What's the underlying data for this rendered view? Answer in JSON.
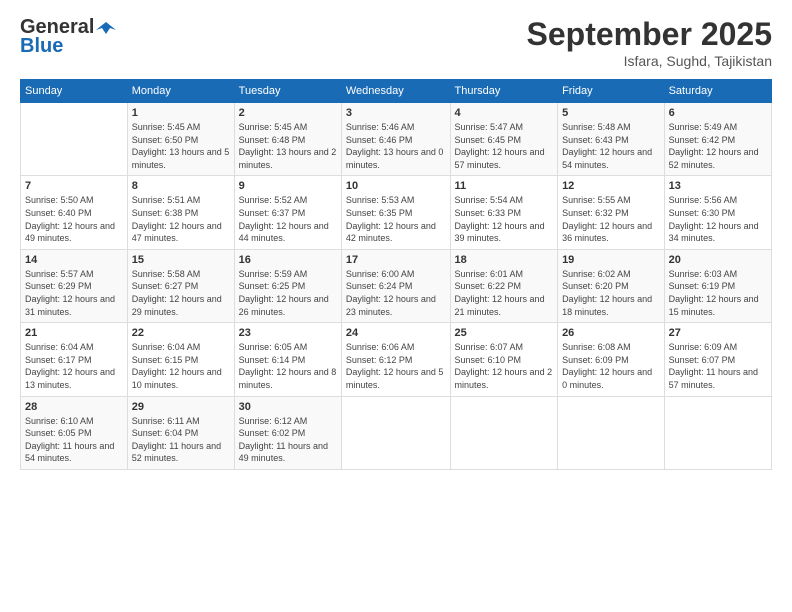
{
  "header": {
    "logo_general": "General",
    "logo_blue": "Blue",
    "month": "September 2025",
    "location": "Isfara, Sughd, Tajikistan"
  },
  "weekdays": [
    "Sunday",
    "Monday",
    "Tuesday",
    "Wednesday",
    "Thursday",
    "Friday",
    "Saturday"
  ],
  "weeks": [
    [
      {
        "day": "",
        "sunrise": "",
        "sunset": "",
        "daylight": ""
      },
      {
        "day": "1",
        "sunrise": "Sunrise: 5:45 AM",
        "sunset": "Sunset: 6:50 PM",
        "daylight": "Daylight: 13 hours and 5 minutes."
      },
      {
        "day": "2",
        "sunrise": "Sunrise: 5:45 AM",
        "sunset": "Sunset: 6:48 PM",
        "daylight": "Daylight: 13 hours and 2 minutes."
      },
      {
        "day": "3",
        "sunrise": "Sunrise: 5:46 AM",
        "sunset": "Sunset: 6:46 PM",
        "daylight": "Daylight: 13 hours and 0 minutes."
      },
      {
        "day": "4",
        "sunrise": "Sunrise: 5:47 AM",
        "sunset": "Sunset: 6:45 PM",
        "daylight": "Daylight: 12 hours and 57 minutes."
      },
      {
        "day": "5",
        "sunrise": "Sunrise: 5:48 AM",
        "sunset": "Sunset: 6:43 PM",
        "daylight": "Daylight: 12 hours and 54 minutes."
      },
      {
        "day": "6",
        "sunrise": "Sunrise: 5:49 AM",
        "sunset": "Sunset: 6:42 PM",
        "daylight": "Daylight: 12 hours and 52 minutes."
      }
    ],
    [
      {
        "day": "7",
        "sunrise": "Sunrise: 5:50 AM",
        "sunset": "Sunset: 6:40 PM",
        "daylight": "Daylight: 12 hours and 49 minutes."
      },
      {
        "day": "8",
        "sunrise": "Sunrise: 5:51 AM",
        "sunset": "Sunset: 6:38 PM",
        "daylight": "Daylight: 12 hours and 47 minutes."
      },
      {
        "day": "9",
        "sunrise": "Sunrise: 5:52 AM",
        "sunset": "Sunset: 6:37 PM",
        "daylight": "Daylight: 12 hours and 44 minutes."
      },
      {
        "day": "10",
        "sunrise": "Sunrise: 5:53 AM",
        "sunset": "Sunset: 6:35 PM",
        "daylight": "Daylight: 12 hours and 42 minutes."
      },
      {
        "day": "11",
        "sunrise": "Sunrise: 5:54 AM",
        "sunset": "Sunset: 6:33 PM",
        "daylight": "Daylight: 12 hours and 39 minutes."
      },
      {
        "day": "12",
        "sunrise": "Sunrise: 5:55 AM",
        "sunset": "Sunset: 6:32 PM",
        "daylight": "Daylight: 12 hours and 36 minutes."
      },
      {
        "day": "13",
        "sunrise": "Sunrise: 5:56 AM",
        "sunset": "Sunset: 6:30 PM",
        "daylight": "Daylight: 12 hours and 34 minutes."
      }
    ],
    [
      {
        "day": "14",
        "sunrise": "Sunrise: 5:57 AM",
        "sunset": "Sunset: 6:29 PM",
        "daylight": "Daylight: 12 hours and 31 minutes."
      },
      {
        "day": "15",
        "sunrise": "Sunrise: 5:58 AM",
        "sunset": "Sunset: 6:27 PM",
        "daylight": "Daylight: 12 hours and 29 minutes."
      },
      {
        "day": "16",
        "sunrise": "Sunrise: 5:59 AM",
        "sunset": "Sunset: 6:25 PM",
        "daylight": "Daylight: 12 hours and 26 minutes."
      },
      {
        "day": "17",
        "sunrise": "Sunrise: 6:00 AM",
        "sunset": "Sunset: 6:24 PM",
        "daylight": "Daylight: 12 hours and 23 minutes."
      },
      {
        "day": "18",
        "sunrise": "Sunrise: 6:01 AM",
        "sunset": "Sunset: 6:22 PM",
        "daylight": "Daylight: 12 hours and 21 minutes."
      },
      {
        "day": "19",
        "sunrise": "Sunrise: 6:02 AM",
        "sunset": "Sunset: 6:20 PM",
        "daylight": "Daylight: 12 hours and 18 minutes."
      },
      {
        "day": "20",
        "sunrise": "Sunrise: 6:03 AM",
        "sunset": "Sunset: 6:19 PM",
        "daylight": "Daylight: 12 hours and 15 minutes."
      }
    ],
    [
      {
        "day": "21",
        "sunrise": "Sunrise: 6:04 AM",
        "sunset": "Sunset: 6:17 PM",
        "daylight": "Daylight: 12 hours and 13 minutes."
      },
      {
        "day": "22",
        "sunrise": "Sunrise: 6:04 AM",
        "sunset": "Sunset: 6:15 PM",
        "daylight": "Daylight: 12 hours and 10 minutes."
      },
      {
        "day": "23",
        "sunrise": "Sunrise: 6:05 AM",
        "sunset": "Sunset: 6:14 PM",
        "daylight": "Daylight: 12 hours and 8 minutes."
      },
      {
        "day": "24",
        "sunrise": "Sunrise: 6:06 AM",
        "sunset": "Sunset: 6:12 PM",
        "daylight": "Daylight: 12 hours and 5 minutes."
      },
      {
        "day": "25",
        "sunrise": "Sunrise: 6:07 AM",
        "sunset": "Sunset: 6:10 PM",
        "daylight": "Daylight: 12 hours and 2 minutes."
      },
      {
        "day": "26",
        "sunrise": "Sunrise: 6:08 AM",
        "sunset": "Sunset: 6:09 PM",
        "daylight": "Daylight: 12 hours and 0 minutes."
      },
      {
        "day": "27",
        "sunrise": "Sunrise: 6:09 AM",
        "sunset": "Sunset: 6:07 PM",
        "daylight": "Daylight: 11 hours and 57 minutes."
      }
    ],
    [
      {
        "day": "28",
        "sunrise": "Sunrise: 6:10 AM",
        "sunset": "Sunset: 6:05 PM",
        "daylight": "Daylight: 11 hours and 54 minutes."
      },
      {
        "day": "29",
        "sunrise": "Sunrise: 6:11 AM",
        "sunset": "Sunset: 6:04 PM",
        "daylight": "Daylight: 11 hours and 52 minutes."
      },
      {
        "day": "30",
        "sunrise": "Sunrise: 6:12 AM",
        "sunset": "Sunset: 6:02 PM",
        "daylight": "Daylight: 11 hours and 49 minutes."
      },
      {
        "day": "",
        "sunrise": "",
        "sunset": "",
        "daylight": ""
      },
      {
        "day": "",
        "sunrise": "",
        "sunset": "",
        "daylight": ""
      },
      {
        "day": "",
        "sunrise": "",
        "sunset": "",
        "daylight": ""
      },
      {
        "day": "",
        "sunrise": "",
        "sunset": "",
        "daylight": ""
      }
    ]
  ]
}
